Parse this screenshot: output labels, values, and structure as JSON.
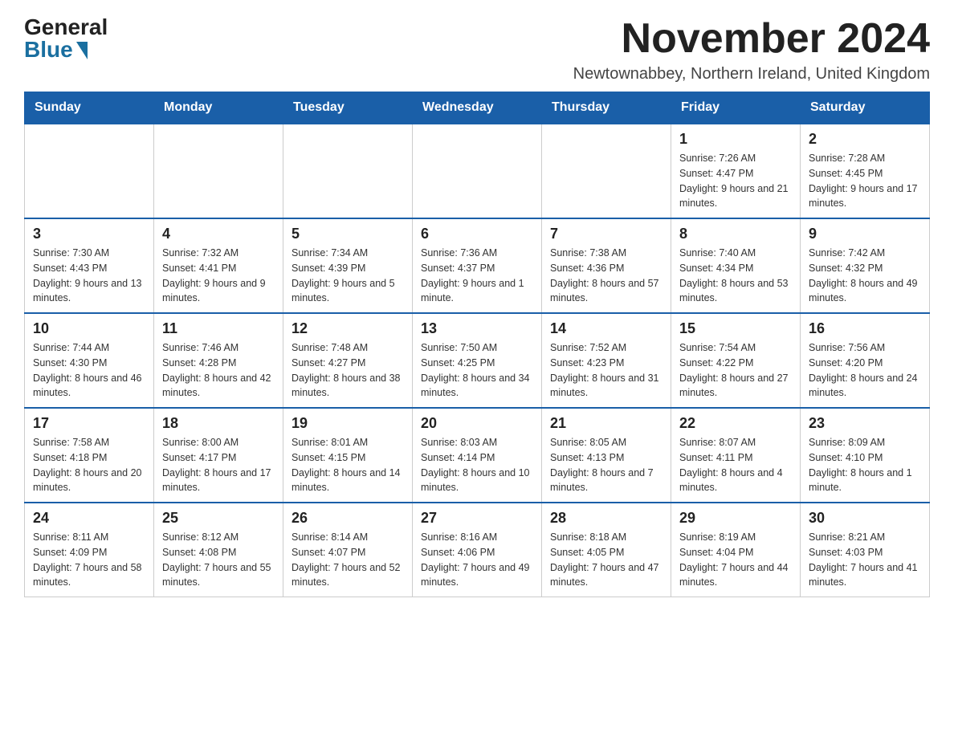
{
  "header": {
    "logo_general": "General",
    "logo_blue": "Blue",
    "month_title": "November 2024",
    "location": "Newtownabbey, Northern Ireland, United Kingdom"
  },
  "days_of_week": [
    "Sunday",
    "Monday",
    "Tuesday",
    "Wednesday",
    "Thursday",
    "Friday",
    "Saturday"
  ],
  "weeks": [
    [
      {
        "day": "",
        "info": ""
      },
      {
        "day": "",
        "info": ""
      },
      {
        "day": "",
        "info": ""
      },
      {
        "day": "",
        "info": ""
      },
      {
        "day": "",
        "info": ""
      },
      {
        "day": "1",
        "info": "Sunrise: 7:26 AM\nSunset: 4:47 PM\nDaylight: 9 hours and 21 minutes."
      },
      {
        "day": "2",
        "info": "Sunrise: 7:28 AM\nSunset: 4:45 PM\nDaylight: 9 hours and 17 minutes."
      }
    ],
    [
      {
        "day": "3",
        "info": "Sunrise: 7:30 AM\nSunset: 4:43 PM\nDaylight: 9 hours and 13 minutes."
      },
      {
        "day": "4",
        "info": "Sunrise: 7:32 AM\nSunset: 4:41 PM\nDaylight: 9 hours and 9 minutes."
      },
      {
        "day": "5",
        "info": "Sunrise: 7:34 AM\nSunset: 4:39 PM\nDaylight: 9 hours and 5 minutes."
      },
      {
        "day": "6",
        "info": "Sunrise: 7:36 AM\nSunset: 4:37 PM\nDaylight: 9 hours and 1 minute."
      },
      {
        "day": "7",
        "info": "Sunrise: 7:38 AM\nSunset: 4:36 PM\nDaylight: 8 hours and 57 minutes."
      },
      {
        "day": "8",
        "info": "Sunrise: 7:40 AM\nSunset: 4:34 PM\nDaylight: 8 hours and 53 minutes."
      },
      {
        "day": "9",
        "info": "Sunrise: 7:42 AM\nSunset: 4:32 PM\nDaylight: 8 hours and 49 minutes."
      }
    ],
    [
      {
        "day": "10",
        "info": "Sunrise: 7:44 AM\nSunset: 4:30 PM\nDaylight: 8 hours and 46 minutes."
      },
      {
        "day": "11",
        "info": "Sunrise: 7:46 AM\nSunset: 4:28 PM\nDaylight: 8 hours and 42 minutes."
      },
      {
        "day": "12",
        "info": "Sunrise: 7:48 AM\nSunset: 4:27 PM\nDaylight: 8 hours and 38 minutes."
      },
      {
        "day": "13",
        "info": "Sunrise: 7:50 AM\nSunset: 4:25 PM\nDaylight: 8 hours and 34 minutes."
      },
      {
        "day": "14",
        "info": "Sunrise: 7:52 AM\nSunset: 4:23 PM\nDaylight: 8 hours and 31 minutes."
      },
      {
        "day": "15",
        "info": "Sunrise: 7:54 AM\nSunset: 4:22 PM\nDaylight: 8 hours and 27 minutes."
      },
      {
        "day": "16",
        "info": "Sunrise: 7:56 AM\nSunset: 4:20 PM\nDaylight: 8 hours and 24 minutes."
      }
    ],
    [
      {
        "day": "17",
        "info": "Sunrise: 7:58 AM\nSunset: 4:18 PM\nDaylight: 8 hours and 20 minutes."
      },
      {
        "day": "18",
        "info": "Sunrise: 8:00 AM\nSunset: 4:17 PM\nDaylight: 8 hours and 17 minutes."
      },
      {
        "day": "19",
        "info": "Sunrise: 8:01 AM\nSunset: 4:15 PM\nDaylight: 8 hours and 14 minutes."
      },
      {
        "day": "20",
        "info": "Sunrise: 8:03 AM\nSunset: 4:14 PM\nDaylight: 8 hours and 10 minutes."
      },
      {
        "day": "21",
        "info": "Sunrise: 8:05 AM\nSunset: 4:13 PM\nDaylight: 8 hours and 7 minutes."
      },
      {
        "day": "22",
        "info": "Sunrise: 8:07 AM\nSunset: 4:11 PM\nDaylight: 8 hours and 4 minutes."
      },
      {
        "day": "23",
        "info": "Sunrise: 8:09 AM\nSunset: 4:10 PM\nDaylight: 8 hours and 1 minute."
      }
    ],
    [
      {
        "day": "24",
        "info": "Sunrise: 8:11 AM\nSunset: 4:09 PM\nDaylight: 7 hours and 58 minutes."
      },
      {
        "day": "25",
        "info": "Sunrise: 8:12 AM\nSunset: 4:08 PM\nDaylight: 7 hours and 55 minutes."
      },
      {
        "day": "26",
        "info": "Sunrise: 8:14 AM\nSunset: 4:07 PM\nDaylight: 7 hours and 52 minutes."
      },
      {
        "day": "27",
        "info": "Sunrise: 8:16 AM\nSunset: 4:06 PM\nDaylight: 7 hours and 49 minutes."
      },
      {
        "day": "28",
        "info": "Sunrise: 8:18 AM\nSunset: 4:05 PM\nDaylight: 7 hours and 47 minutes."
      },
      {
        "day": "29",
        "info": "Sunrise: 8:19 AM\nSunset: 4:04 PM\nDaylight: 7 hours and 44 minutes."
      },
      {
        "day": "30",
        "info": "Sunrise: 8:21 AM\nSunset: 4:03 PM\nDaylight: 7 hours and 41 minutes."
      }
    ]
  ]
}
